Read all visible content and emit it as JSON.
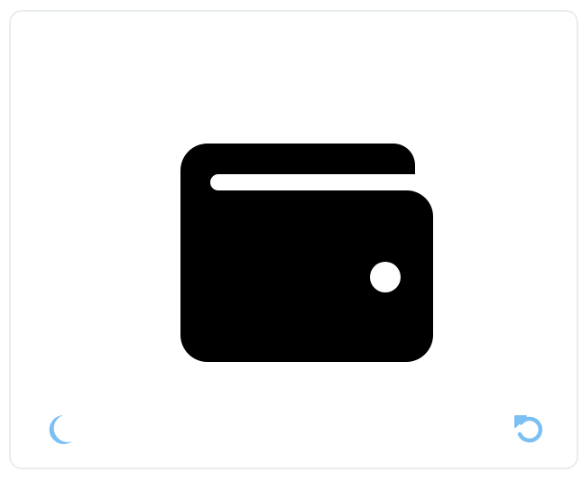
{
  "card": {
    "icon_name": "wallet-icon",
    "icon_color": "#000000"
  },
  "controls": {
    "theme_toggle": {
      "icon": "moon-icon",
      "color": "#7cc0f3"
    },
    "reset": {
      "icon": "rotate-left-icon",
      "color": "#7cc0f3"
    }
  },
  "colors": {
    "background": "#ffffff",
    "card_border": "#e9ecef"
  }
}
